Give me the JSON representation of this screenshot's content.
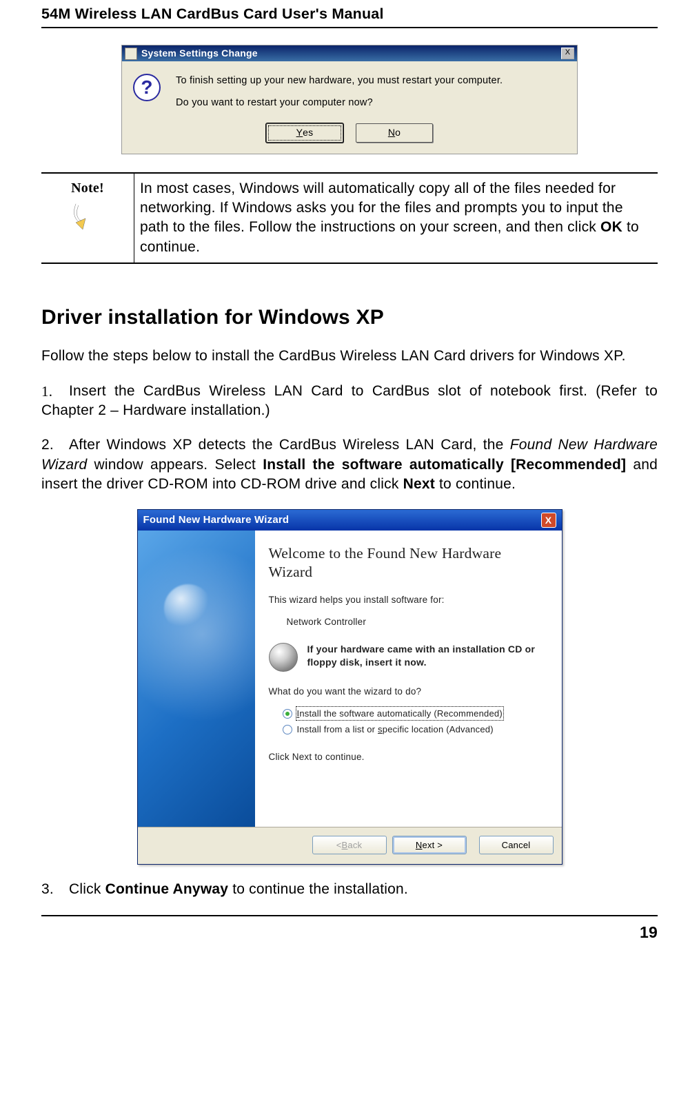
{
  "header": {
    "title": "54M Wireless LAN CardBus Card User's Manual"
  },
  "dialog1": {
    "title": "System Settings Change",
    "close_x": "X",
    "msg_line1": "To finish setting up your new hardware, you must restart your computer.",
    "msg_line2": "Do you want to restart your computer now?",
    "yes_prefix": "",
    "yes_accel": "Y",
    "yes_suffix": "es",
    "no_prefix": "",
    "no_accel": "N",
    "no_suffix": "o",
    "q": "?"
  },
  "note": {
    "label": "Note!",
    "text_pre": "In most cases, Windows will automatically copy all of the files needed for networking. If Windows asks you for the files and prompts you to input the path to the files. Follow the instructions on your screen, and then click ",
    "text_bold": "OK",
    "text_post": " to continue."
  },
  "section_title": "Driver installation for Windows XP",
  "intro": "Follow the steps below to install the CardBus Wireless LAN Card drivers for Windows XP.",
  "steps": {
    "s1": {
      "num": "1.",
      "text": "Insert the CardBus Wireless LAN Card to CardBus slot of notebook first. (Refer to Chapter 2 – Hardware installation.)"
    },
    "s2": {
      "num": "2.",
      "t1": "After Windows XP detects the CardBus Wireless LAN Card, the ",
      "t2_i": "Found New Hardware Wizard",
      "t3": " window appears. Select ",
      "t4_b": "Install the software automatically [Recommended]",
      "t5": " and insert the driver CD-ROM into CD-ROM drive and click ",
      "t6_b": "Next",
      "t7": " to continue."
    },
    "s3": {
      "num": "3.",
      "t1": "Click ",
      "t2_b": "Continue Anyway",
      "t3": " to continue the installation."
    }
  },
  "wizard": {
    "title": "Found New Hardware Wizard",
    "close_x": "X",
    "heading": "Welcome to the Found New Hardware Wizard",
    "help_line": "This wizard helps you install software for:",
    "device": "Network Controller",
    "cd_line": "If your hardware came with an installation CD or floppy disk, insert it now.",
    "question": "What do you want the wizard to do?",
    "opt1_pre": "",
    "opt1_u": "I",
    "opt1_post": "nstall the software automatically (Recommended)",
    "opt2_pre": "Install from a list or ",
    "opt2_u": "s",
    "opt2_post": "pecific location (Advanced)",
    "next_hint": "Click Next to continue.",
    "back_lt": "< ",
    "back_u": "B",
    "back_post": "ack",
    "next_u": "N",
    "next_post": "ext >",
    "cancel": "Cancel"
  },
  "page_number": "19",
  "colors": {
    "accent_blue": "#0a246a",
    "xp_blue": "#2b6bd4"
  }
}
